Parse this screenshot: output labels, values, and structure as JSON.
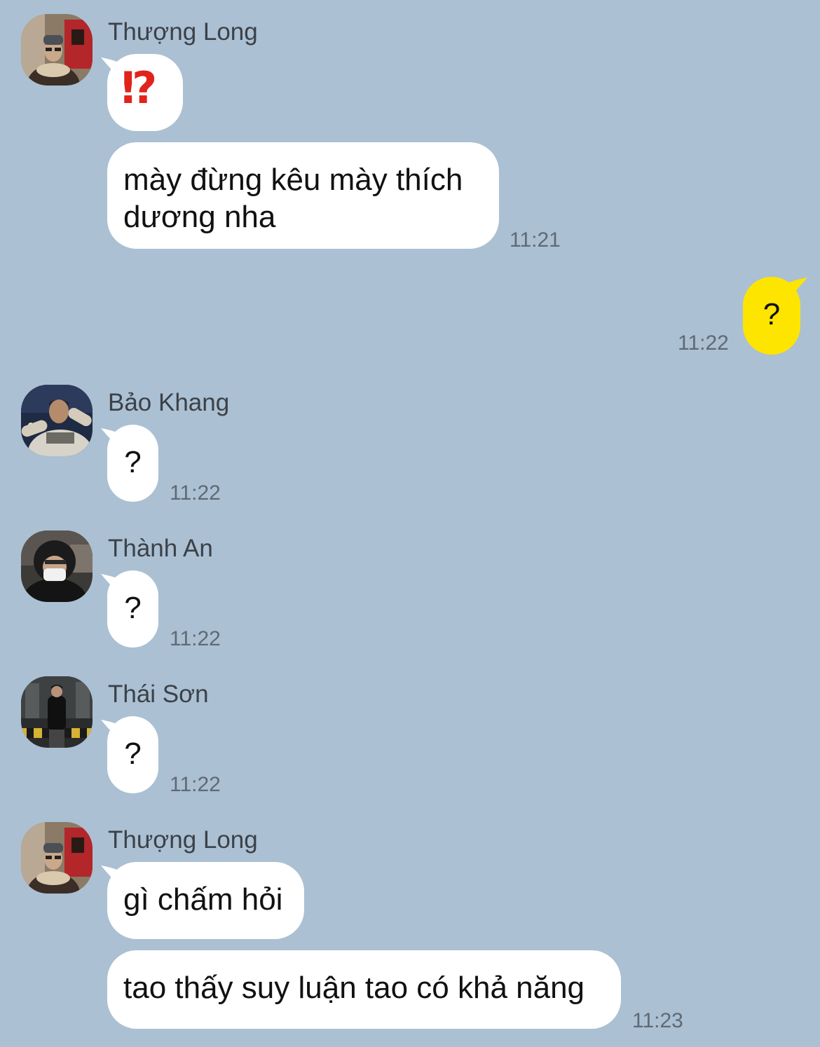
{
  "messages": [
    {
      "sender": "Thượng Long",
      "bubbles": [
        "⁉",
        "mày đừng kêu mày thích\ndương nha"
      ],
      "time": "11:21"
    },
    {
      "sender": "",
      "mine": true,
      "bubbles": [
        "?"
      ],
      "time": "11:22"
    },
    {
      "sender": "Bảo Khang",
      "bubbles": [
        "?"
      ],
      "time": "11:22"
    },
    {
      "sender": "Thành An",
      "bubbles": [
        "?"
      ],
      "time": "11:22"
    },
    {
      "sender": "Thái Sơn",
      "bubbles": [
        "?"
      ],
      "time": "11:22"
    },
    {
      "sender": "Thượng Long",
      "bubbles": [
        "gì chấm hỏi",
        "tao thấy suy luận tao có khả năng"
      ],
      "time": "11:23"
    }
  ],
  "colors": {
    "background": "#abc0d3",
    "incoming_bubble": "#ffffff",
    "outgoing_bubble": "#fee500",
    "interrobang": "#e0231b"
  },
  "icons": {
    "interrobang": "exclamation-question-mark-emoji"
  }
}
